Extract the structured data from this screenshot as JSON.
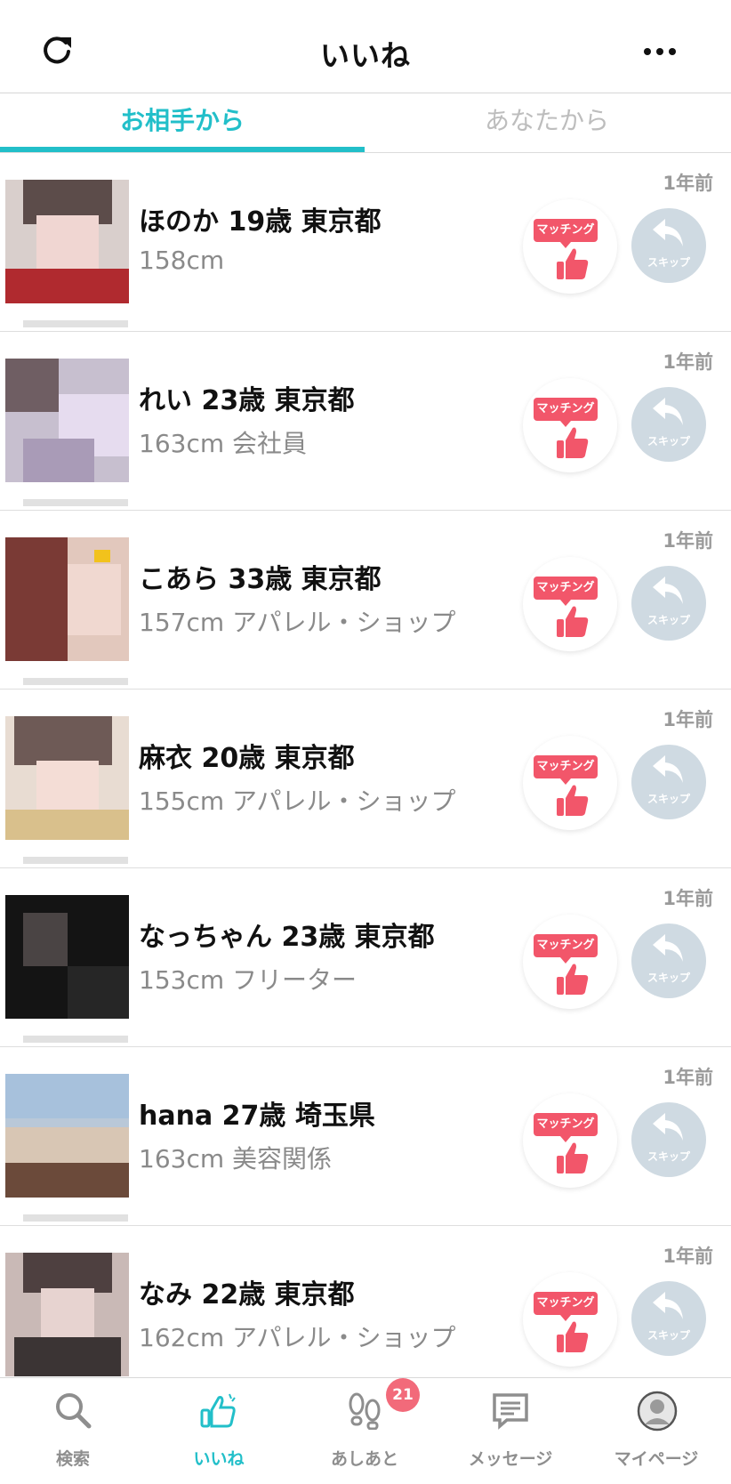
{
  "header": {
    "title": "いいね",
    "refresh_icon": "refresh-icon",
    "more_icon": "more-dots-icon"
  },
  "tabs": [
    {
      "label": "お相手から",
      "active": true
    },
    {
      "label": "あなたから",
      "active": false
    }
  ],
  "colors": {
    "accent": "#22bfc9",
    "match_red": "#f2566a",
    "skip_gray": "#cfdae2",
    "badge": "#f26a7a"
  },
  "actions": {
    "match_label": "マッチング",
    "skip_label": "スキップ"
  },
  "likes": [
    {
      "time": "1年前",
      "name": "ほのか 19歳 東京都",
      "details": "158cm"
    },
    {
      "time": "1年前",
      "name": "れい 23歳 東京都",
      "details": "163cm  会社員"
    },
    {
      "time": "1年前",
      "name": "こあら 33歳 東京都",
      "details": "157cm  アパレル・ショップ"
    },
    {
      "time": "1年前",
      "name": "麻衣 20歳 東京都",
      "details": "155cm  アパレル・ショップ"
    },
    {
      "time": "1年前",
      "name": "なっちゃん 23歳 東京都",
      "details": "153cm  フリーター"
    },
    {
      "time": "1年前",
      "name": "hana 27歳 埼玉県",
      "details": "163cm  美容関係"
    },
    {
      "time": "1年前",
      "name": "なみ 22歳 東京都",
      "details": "162cm  アパレル・ショップ"
    }
  ],
  "bottom_nav": [
    {
      "label": "検索",
      "icon": "search-icon",
      "active": false
    },
    {
      "label": "いいね",
      "icon": "like-icon",
      "active": true
    },
    {
      "label": "あしあと",
      "icon": "footprints-icon",
      "active": false,
      "badge": "21"
    },
    {
      "label": "メッセージ",
      "icon": "message-icon",
      "active": false
    },
    {
      "label": "マイページ",
      "icon": "profile-icon",
      "active": false
    }
  ]
}
